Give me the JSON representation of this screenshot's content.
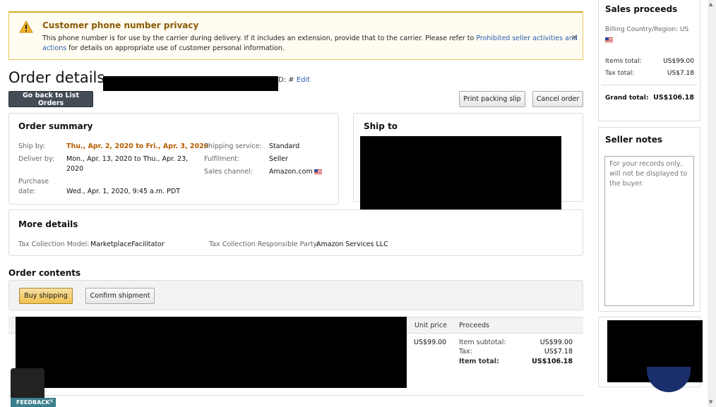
{
  "alert": {
    "title": "Customer phone number privacy",
    "body_prefix": "This phone number is for use by the carrier during delivery. If it includes an extension, provide that to the carrier. Please refer to ",
    "link_text": "Prohibited seller activities and actions",
    "body_suffix": " for details on appropriate use of customer personal information.",
    "close": "×"
  },
  "header": {
    "title": "Order details",
    "order_id_label": "D: #",
    "edit_link": "Edit"
  },
  "buttons": {
    "back": "Go back to List Orders",
    "print": "Print packing slip",
    "cancel": "Cancel order",
    "buy_shipping": "Buy shipping",
    "confirm_shipment": "Confirm shipment"
  },
  "order_summary": {
    "title": "Order summary",
    "ship_by_label": "Ship by:",
    "ship_by_value": "Thu., Apr. 2, 2020 to Fri., Apr. 3, 2020",
    "deliver_by_label": "Deliver by:",
    "deliver_by_line1": "Mon., Apr. 13, 2020 to Thu., Apr. 23,",
    "deliver_by_line2": "2020",
    "purchase_label_line1": "Purchase",
    "purchase_label_line2": "date:",
    "purchase_value": "Wed., Apr. 1, 2020, 9:45 a.m. PDT",
    "shipping_service_label": "Shipping service:",
    "shipping_service_value": "Standard",
    "fulfilment_label": "Fulfilment:",
    "fulfilment_value": "Seller",
    "sales_channel_label": "Sales channel:",
    "sales_channel_value": "Amazon.com"
  },
  "ship_to": {
    "title": "Ship to"
  },
  "more_details": {
    "title": "More details",
    "tax_model_label": "Tax Collection Model:",
    "tax_model_value": "MarketplaceFacilitator",
    "tax_party_label": "Tax Collection Responsible Party:",
    "tax_party_value": "Amazon Services LLC"
  },
  "order_contents": {
    "title": "Order contents",
    "col_unit_price": "Unit price",
    "col_proceeds": "Proceeds",
    "unit_price": "US$99.00",
    "item_subtotal_label": "Item subtotal:",
    "item_subtotal_value": "US$99.00",
    "tax_label": "Tax:",
    "tax_value": "US$7.18",
    "item_total_label": "Item total:",
    "item_total_value": "US$106.18"
  },
  "sales_proceeds": {
    "title": "Sales proceeds",
    "billing_label": "Billing Country/Region: US",
    "items_total_label": "Items total:",
    "items_total_value": "US$99.00",
    "tax_total_label": "Tax total:",
    "tax_total_value": "US$7.18",
    "grand_total_label": "Grand total:",
    "grand_total_value": "US$106.18"
  },
  "seller_notes": {
    "title": "Seller notes",
    "placeholder": "For your records only, will not be displayed to the buyer."
  },
  "feedback": {
    "label": "FEEDBACK",
    "close": "×"
  },
  "colors": {
    "accent_link": "#2a5db0",
    "ship_by": "#b85c00",
    "alert_border": "#d9a923",
    "feedback": "#3b7e8e"
  }
}
